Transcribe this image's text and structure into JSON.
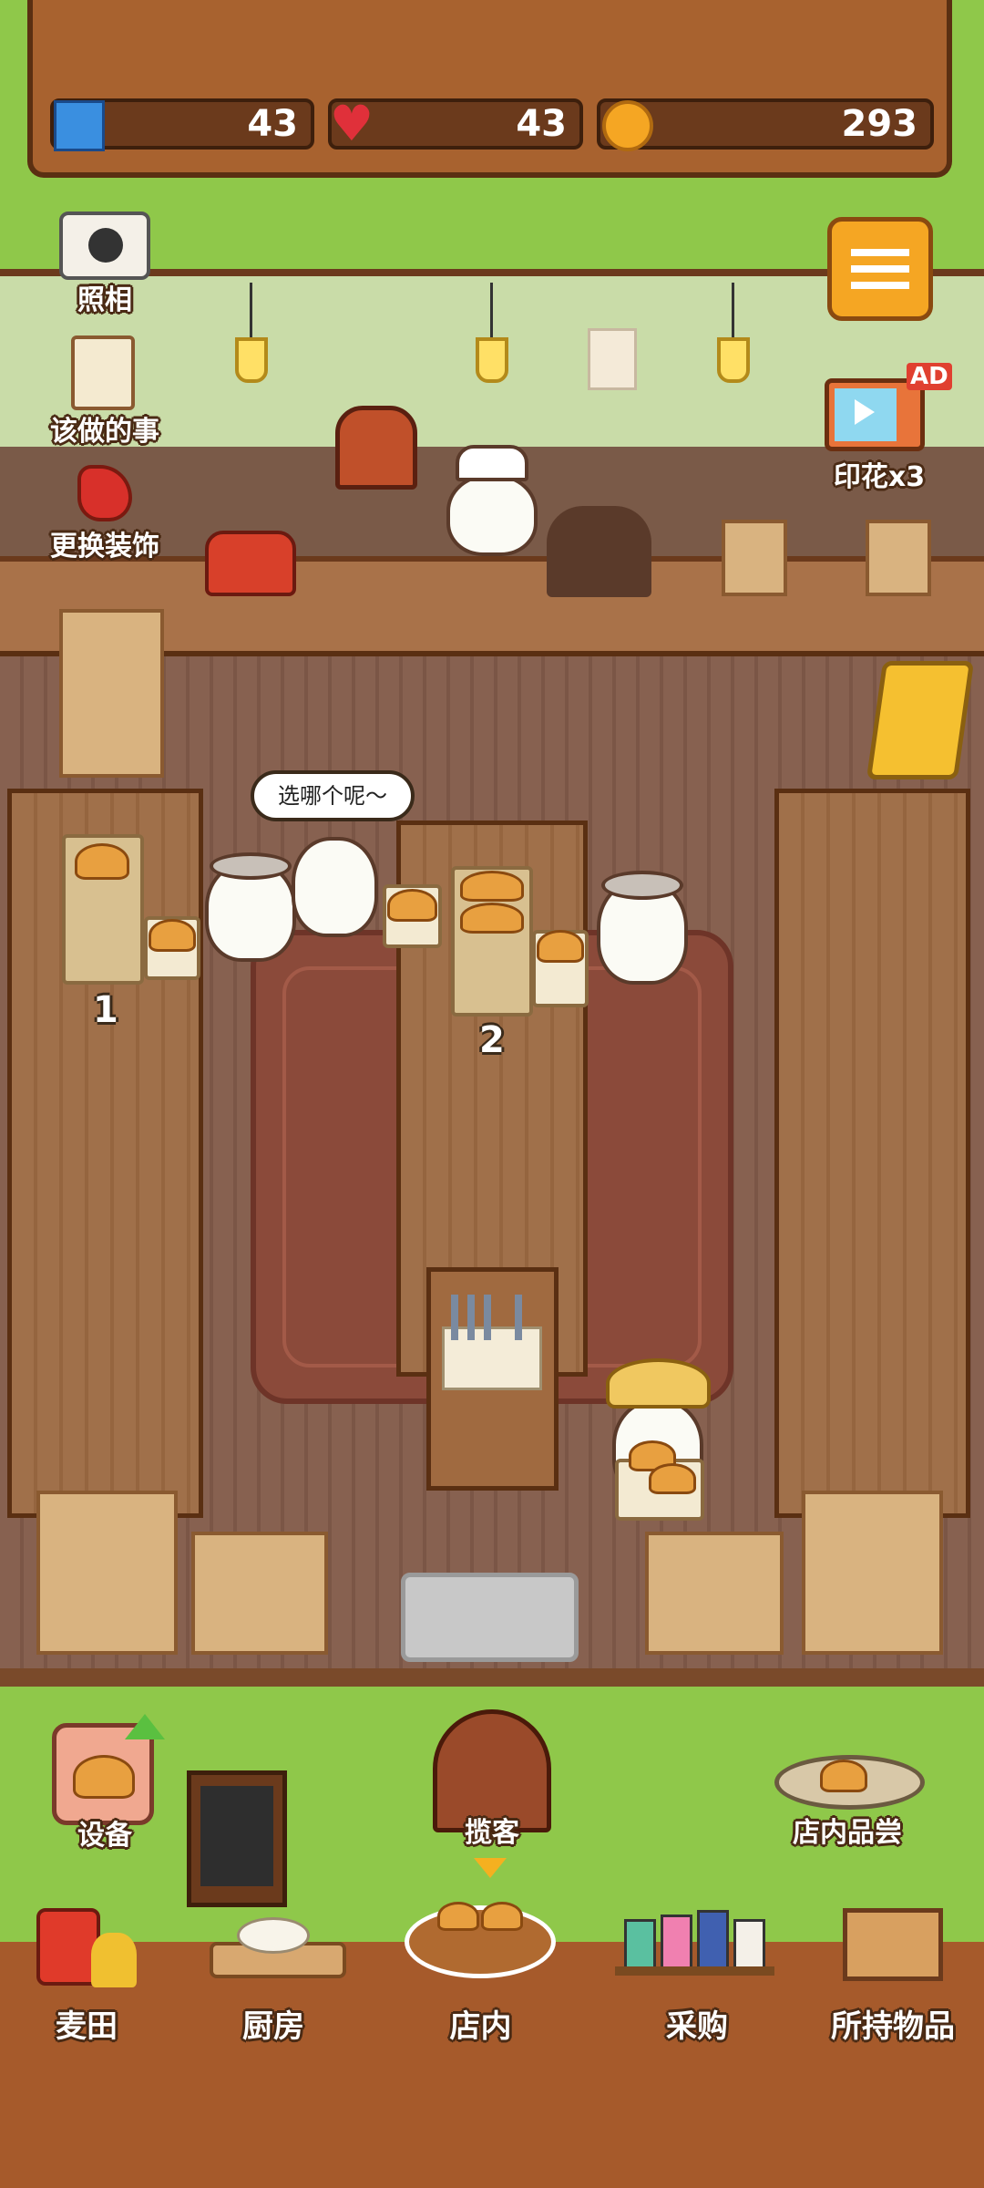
{
  "header": {
    "tickets": "43",
    "hearts": "43",
    "coins": "293"
  },
  "side_buttons": {
    "photo": "照相",
    "todo": "该做的事",
    "decorate": "更换装饰",
    "stamp_ad": "印花x3",
    "ad_badge": "AD"
  },
  "scene": {
    "speech": "选哪个呢～",
    "shelf1_number": "1",
    "shelf2_number": "2"
  },
  "actions": {
    "equipment": "设备",
    "attract": "揽客",
    "tasting": "店内品尝"
  },
  "bottom_nav": [
    {
      "label": "麦田"
    },
    {
      "label": "厨房"
    },
    {
      "label": "店内"
    },
    {
      "label": "采购"
    },
    {
      "label": "所持物品"
    }
  ],
  "colors": {
    "grass": "#8fc84a",
    "wood": "#a8622f",
    "menu_button": "#f5a623"
  }
}
